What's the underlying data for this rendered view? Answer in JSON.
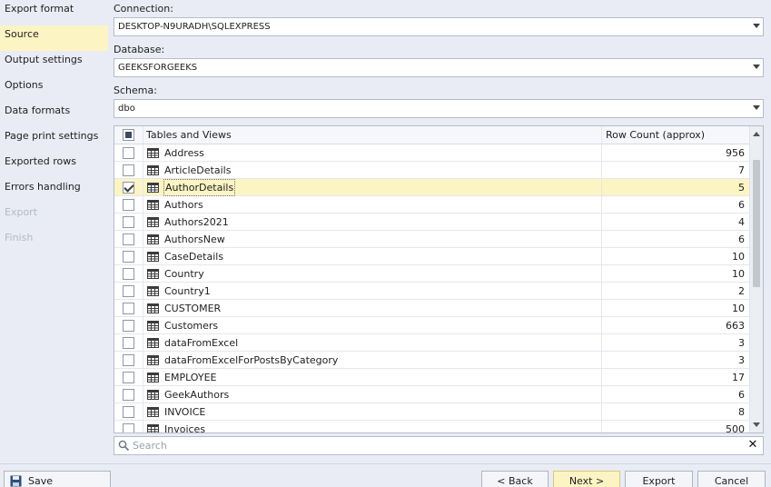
{
  "nav": {
    "items": [
      {
        "label": "Export format",
        "state": "normal"
      },
      {
        "label": "Source",
        "state": "selected"
      },
      {
        "label": "Output settings",
        "state": "normal"
      },
      {
        "label": "Options",
        "state": "normal"
      },
      {
        "label": "Data formats",
        "state": "normal"
      },
      {
        "label": "Page print settings",
        "state": "normal"
      },
      {
        "label": "Exported rows",
        "state": "normal"
      },
      {
        "label": "Errors handling",
        "state": "normal"
      },
      {
        "label": "Export",
        "state": "disabled"
      },
      {
        "label": "Finish",
        "state": "disabled"
      }
    ]
  },
  "source": {
    "connection_label": "Connection:",
    "connection_value": "DESKTOP-N9URADH\\SQLEXPRESS",
    "database_label": "Database:",
    "database_value": "GEEKSFORGEEKS",
    "schema_label": "Schema:",
    "schema_value": "dbo"
  },
  "grid": {
    "col_tables": "Tables and Views",
    "col_rowcount": "Row Count (approx)",
    "rows": [
      {
        "name": "Address",
        "count": "956",
        "checked": false,
        "selected": false
      },
      {
        "name": "ArticleDetails",
        "count": "7",
        "checked": false,
        "selected": false
      },
      {
        "name": "AuthorDetails",
        "count": "5",
        "checked": true,
        "selected": true
      },
      {
        "name": "Authors",
        "count": "6",
        "checked": false,
        "selected": false
      },
      {
        "name": "Authors2021",
        "count": "4",
        "checked": false,
        "selected": false
      },
      {
        "name": "AuthorsNew",
        "count": "6",
        "checked": false,
        "selected": false
      },
      {
        "name": "CaseDetails",
        "count": "10",
        "checked": false,
        "selected": false
      },
      {
        "name": "Country",
        "count": "10",
        "checked": false,
        "selected": false
      },
      {
        "name": "Country1",
        "count": "2",
        "checked": false,
        "selected": false
      },
      {
        "name": "CUSTOMER",
        "count": "10",
        "checked": false,
        "selected": false
      },
      {
        "name": "Customers",
        "count": "663",
        "checked": false,
        "selected": false
      },
      {
        "name": "dataFromExcel",
        "count": "3",
        "checked": false,
        "selected": false
      },
      {
        "name": "dataFromExcelForPostsByCategory",
        "count": "3",
        "checked": false,
        "selected": false
      },
      {
        "name": "EMPLOYEE",
        "count": "17",
        "checked": false,
        "selected": false
      },
      {
        "name": "GeekAuthors",
        "count": "6",
        "checked": false,
        "selected": false
      },
      {
        "name": "INVOICE",
        "count": "8",
        "checked": false,
        "selected": false
      },
      {
        "name": "Invoices",
        "count": "500",
        "checked": false,
        "selected": false
      }
    ]
  },
  "search": {
    "placeholder": "Search"
  },
  "footer": {
    "save_template": "Save Template...",
    "back": "< Back",
    "next": "Next >",
    "export": "Export",
    "cancel": "Cancel"
  },
  "colors": {
    "panel_bg": "#e9ecf4",
    "selection": "#fdf4c4"
  }
}
